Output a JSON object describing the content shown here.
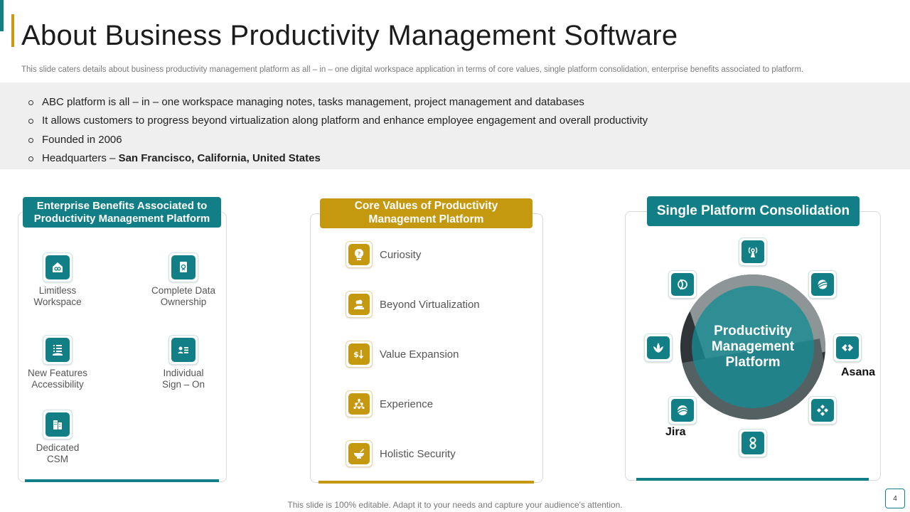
{
  "slide": {
    "title": "About Business Productivity Management Software",
    "subtitle": "This slide caters details about business productivity management platform as all – in – one digital workspace application in terms of core values, single platform consolidation, enterprise benefits associated to platform.",
    "page_number": "4",
    "footer": "This slide is 100% editable. Adapt it to your needs and capture your audience's attention."
  },
  "about": {
    "bullets": [
      {
        "text": "ABC platform is all – in – one workspace managing notes, tasks management, project management and databases"
      },
      {
        "text": "It allows customers to progress beyond virtualization along platform and enhance employee engagement and overall productivity"
      },
      {
        "text": "Founded in 2006"
      },
      {
        "text": "Headquarters – ",
        "bold": "San Francisco, California, United States"
      }
    ]
  },
  "benefits": {
    "header": "Enterprise Benefits Associated to Productivity Management Platform",
    "items": [
      {
        "label_line1": "Limitless",
        "label_line2": "Workspace",
        "icon": "workspace-icon"
      },
      {
        "label_line1": "Complete Data",
        "label_line2": "Ownership",
        "icon": "data-ownership-icon"
      },
      {
        "label_line1": "New Features",
        "label_line2": "Accessibility",
        "icon": "features-list-icon"
      },
      {
        "label_line1": "Individual",
        "label_line2": "Sign – On",
        "icon": "id-card-icon"
      },
      {
        "label_line1": "Dedicated",
        "label_line2": "CSM",
        "icon": "building-icon"
      }
    ]
  },
  "core_values": {
    "header": "Core Values of Productivity Management Platform",
    "items": [
      {
        "label": "Curiosity",
        "icon": "lightbulb-icon"
      },
      {
        "label": "Beyond Virtualization",
        "icon": "cloud-hand-icon"
      },
      {
        "label": "Value Expansion",
        "icon": "dollar-arrows-icon"
      },
      {
        "label": "Experience",
        "icon": "team-pyramid-icon"
      },
      {
        "label": "Holistic Security",
        "icon": "mortar-bowl-icon"
      }
    ]
  },
  "consolidation": {
    "header": "Single Platform Consolidation",
    "center_label": "Productivity Management Platform",
    "brand_labels": {
      "right": "Asana",
      "left": "Jira"
    }
  },
  "colors": {
    "teal": "#127f86",
    "gold": "#c4980f"
  }
}
